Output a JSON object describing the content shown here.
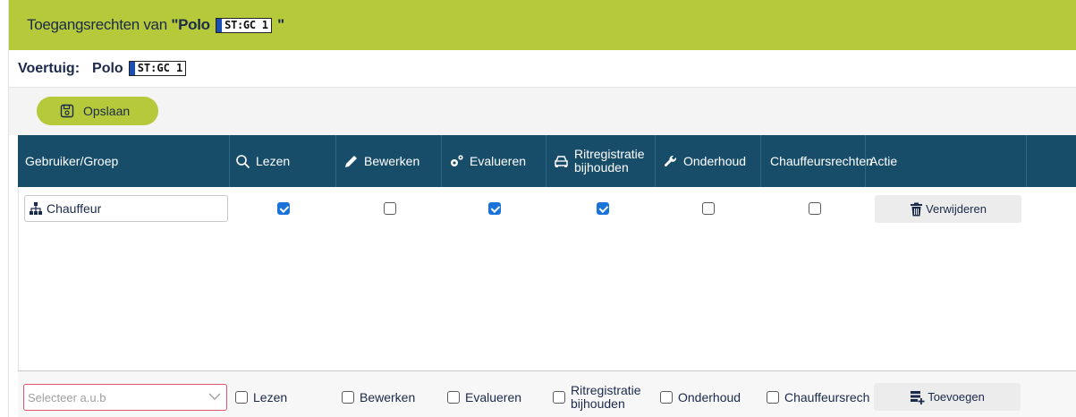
{
  "dialog": {
    "title_prefix": "Toegangsrechten van",
    "title_open": "\"Polo",
    "title_close": "\"",
    "plate_text": "ST:GC 1"
  },
  "vehicle": {
    "label": "Voertuig:",
    "name": "Polo",
    "plate_text": "ST:GC 1"
  },
  "toolbar": {
    "save_label": "Opslaan"
  },
  "columns": {
    "user": "Gebruiker/Groep",
    "read": "Lezen",
    "edit": "Bewerken",
    "evaluate": "Evalueren",
    "trip_line1": "Ritregistratie",
    "trip_line2": "bijhouden",
    "maintenance": "Onderhoud",
    "driver_rights": "Chauffeursrechten",
    "action": "Actie"
  },
  "rows": [
    {
      "user": "Chauffeur",
      "read": true,
      "edit": false,
      "evaluate": true,
      "trip": true,
      "maintenance": false,
      "driver_rights": false,
      "delete_label": "Verwijderen"
    }
  ],
  "footer": {
    "select_placeholder": "Selecteer a.u.b",
    "read": "Lezen",
    "edit": "Bewerken",
    "evaluate": "Evalueren",
    "trip_line1": "Ritregistratie",
    "trip_line2": "bijhouden",
    "maintenance": "Onderhoud",
    "driver_rights": "Chauffeursrech",
    "add_label": "Toevoegen"
  },
  "colors": {
    "accent": "#b6c93a",
    "header_bg": "#174d69",
    "checkbox_checked": "#1a73d9",
    "text": "#1b2a4a",
    "invalid_border": "#e0556c"
  },
  "icons": {
    "save": "floppy-disk-icon",
    "read": "magnifier-icon",
    "edit": "pencil-icon",
    "evaluate": "gears-icon",
    "trip": "car-icon",
    "maintenance": "wrench-icon",
    "group": "group-hierarchy-icon",
    "delete": "trash-icon",
    "add": "add-list-icon",
    "dropdown": "chevron-down-icon"
  }
}
